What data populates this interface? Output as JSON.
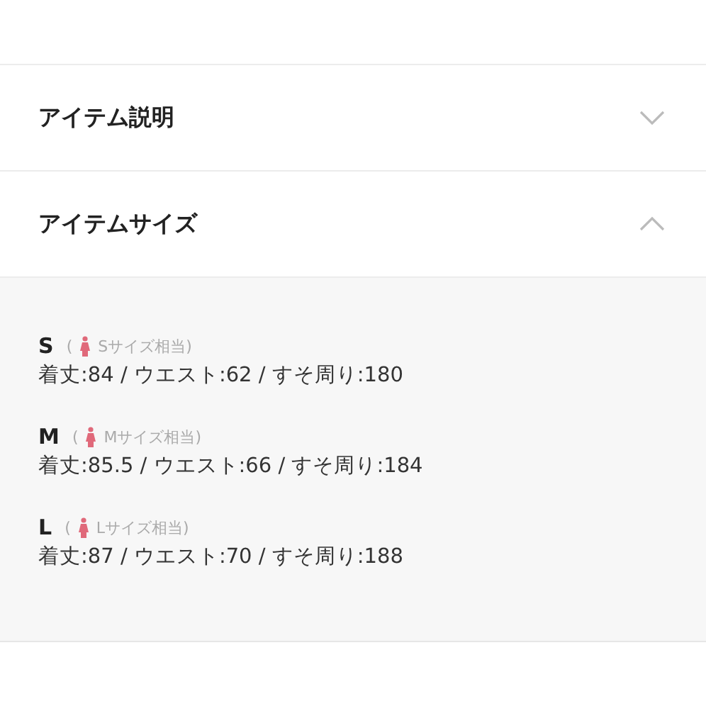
{
  "sections": [
    {
      "title": "アイテム説明",
      "expanded": false
    },
    {
      "title": "アイテムサイズ",
      "expanded": true,
      "sizes": [
        {
          "size": "S",
          "note_open": "(",
          "note": "Sサイズ相当)",
          "measurements": "着丈:84 / ウエスト:62 / すそ周り:180"
        },
        {
          "size": "M",
          "note_open": "(",
          "note": "Mサイズ相当)",
          "measurements": "着丈:85.5 / ウエスト:66 / すそ周り:184"
        },
        {
          "size": "L",
          "note_open": "(",
          "note": "Lサイズ相当)",
          "measurements": "着丈:87 / ウエスト:70 / すそ周り:188"
        }
      ]
    }
  ]
}
